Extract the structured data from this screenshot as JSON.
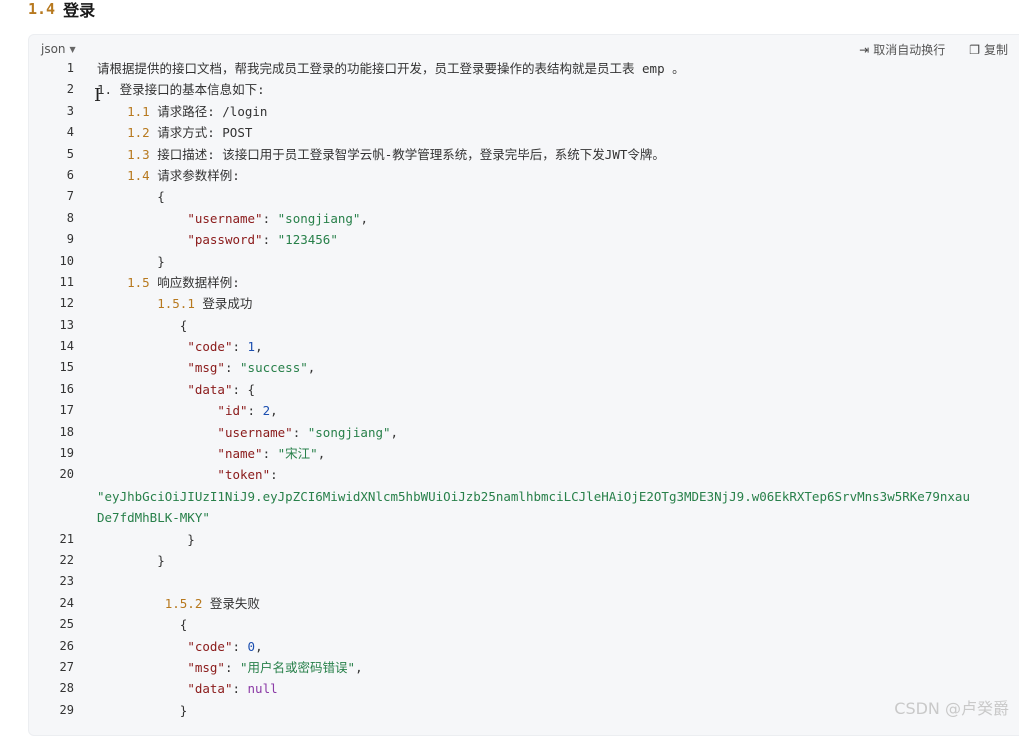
{
  "heading": {
    "number": "1.4",
    "title": "登录"
  },
  "toolbar": {
    "lang": "json",
    "caret_icon": "chevron-down-icon",
    "cancel_wrap_label": "取消自动换行",
    "copy_label": "复制"
  },
  "code_lines": [
    {
      "n": "1",
      "text": "请根据提供的接口文档，帮我完成员工登录的功能接口开发，员工登录要操作的表结构就是员工表 emp 。"
    },
    {
      "n": "2",
      "text": "1. 登录接口的基本信息如下:"
    },
    {
      "n": "3",
      "text": "    1.1 请求路径: /login"
    },
    {
      "n": "4",
      "text": "    1.2 请求方式: POST"
    },
    {
      "n": "5",
      "text": "    1.3 接口描述: 该接口用于员工登录智学云帆-教学管理系统，登录完毕后，系统下发JWT令牌。"
    },
    {
      "n": "6",
      "text": "    1.4 请求参数样例:"
    },
    {
      "n": "7",
      "text": "        {"
    },
    {
      "n": "8",
      "text": "            \"username\": \"songjiang\","
    },
    {
      "n": "9",
      "text": "            \"password\": \"123456\""
    },
    {
      "n": "10",
      "text": "        }"
    },
    {
      "n": "11",
      "text": "    1.5 响应数据样例:"
    },
    {
      "n": "12",
      "text": "        1.5.1 登录成功"
    },
    {
      "n": "13",
      "text": "           {"
    },
    {
      "n": "14",
      "text": "            \"code\": 1,"
    },
    {
      "n": "15",
      "text": "            \"msg\": \"success\","
    },
    {
      "n": "16",
      "text": "            \"data\": {"
    },
    {
      "n": "17",
      "text": "                \"id\": 2,"
    },
    {
      "n": "18",
      "text": "                \"username\": \"songjiang\","
    },
    {
      "n": "19",
      "text": "                \"name\": \"宋江\","
    },
    {
      "n": "20",
      "text": "                \"token\":"
    },
    {
      "n": "",
      "text": "\"eyJhbGciOiJIUzI1NiJ9.eyJpZCI6MiwidXNlcm5hbWUiOiJzb25namlhbmciLCJleHAiOjE2OTg3MDE3NjJ9.w06EkRXTep6SrvMns3w5RKe79nxau"
    },
    {
      "n": "",
      "text": "De7fdMhBLK-MKY\""
    },
    {
      "n": "21",
      "text": "            }"
    },
    {
      "n": "22",
      "text": "        }"
    },
    {
      "n": "23",
      "text": ""
    },
    {
      "n": "24",
      "text": "         1.5.2 登录失败"
    },
    {
      "n": "25",
      "text": "           {"
    },
    {
      "n": "26",
      "text": "            \"code\": 0,"
    },
    {
      "n": "27",
      "text": "            \"msg\": \"用户名或密码错误\","
    },
    {
      "n": "28",
      "text": "            \"data\": null"
    },
    {
      "n": "29",
      "text": "           }"
    }
  ],
  "watermark": "CSDN @卢癸爵"
}
